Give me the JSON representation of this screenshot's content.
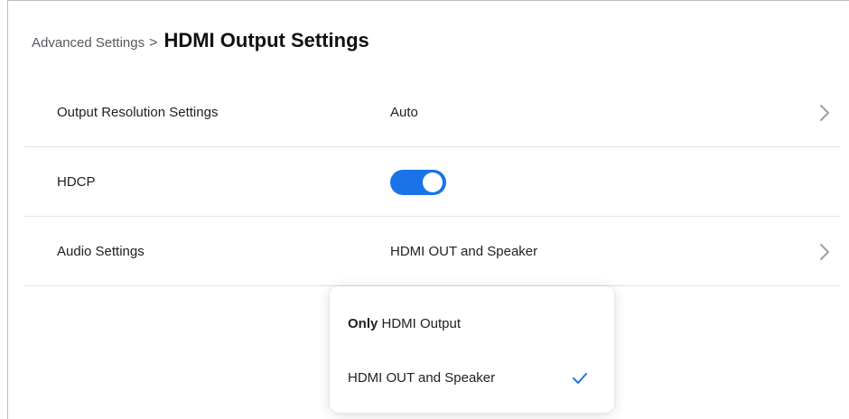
{
  "header": {
    "breadcrumb": "Advanced Settings",
    "separator": ">",
    "title": "HDMI Output Settings"
  },
  "rows": [
    {
      "label": "Output Resolution Settings",
      "value": "Auto",
      "icon": "chevron-right-icon"
    },
    {
      "label": "HDCP",
      "toggle_on": true
    },
    {
      "label": "Audio Settings",
      "value": "HDMI OUT and Speaker",
      "icon": "chevron-right-icon"
    }
  ],
  "popup": {
    "options": [
      {
        "label_prefix": "Only",
        "label_rest": " HDMI Output",
        "selected": false
      },
      {
        "label": "HDMI OUT and Speaker",
        "selected": true,
        "icon": "checkmark-icon"
      }
    ]
  },
  "colors": {
    "accent": "#1a73e8",
    "text": "#202124",
    "muted": "#555a60",
    "divider": "#e3e3e3",
    "chevron": "#9aa0a6"
  }
}
